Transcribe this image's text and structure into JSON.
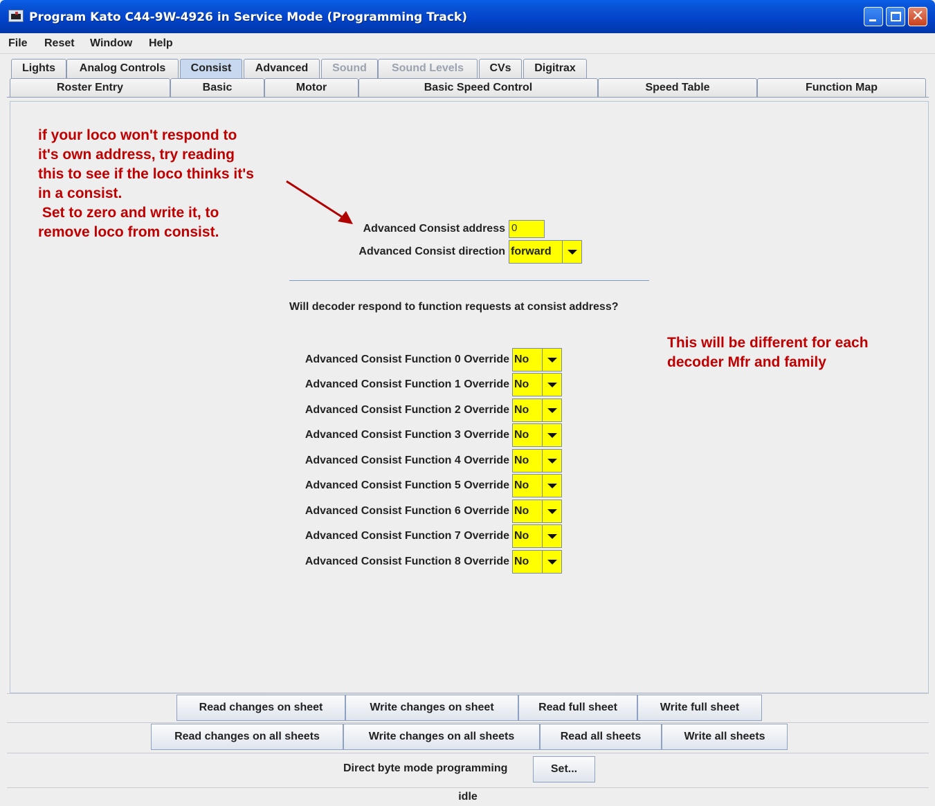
{
  "window": {
    "title": "Program Kato C44-9W-4926 in Service Mode (Programming Track)"
  },
  "menubar": {
    "items": [
      "File",
      "Reset",
      "Window",
      "Help"
    ]
  },
  "tabs": {
    "row1": [
      {
        "label": "Lights",
        "state": "normal"
      },
      {
        "label": "Analog Controls",
        "state": "normal"
      },
      {
        "label": "Consist",
        "state": "selected"
      },
      {
        "label": "Advanced",
        "state": "normal"
      },
      {
        "label": "Sound",
        "state": "disabled"
      },
      {
        "label": "Sound Levels",
        "state": "disabled"
      },
      {
        "label": "CVs",
        "state": "normal"
      },
      {
        "label": "Digitrax",
        "state": "normal"
      }
    ],
    "row2": [
      {
        "label": "Roster Entry"
      },
      {
        "label": "Basic"
      },
      {
        "label": "Motor"
      },
      {
        "label": "Basic Speed Control"
      },
      {
        "label": "Speed Table"
      },
      {
        "label": "Function Map"
      }
    ]
  },
  "annotations": {
    "left": [
      "if your loco won't respond to",
      "it's own address, try reading",
      "this to see if the loco thinks it's",
      "in a consist.",
      " Set to zero and write it, to",
      "remove loco from consist."
    ],
    "right": [
      "This will be different for each",
      "decoder Mfr and family"
    ],
    "color": "#c00000"
  },
  "consist": {
    "address_label": "Advanced Consist address",
    "address_value": "0",
    "direction_label": "Advanced Consist direction",
    "direction_value": "forward",
    "question": "Will decoder respond to function requests at consist address?",
    "overrides": [
      {
        "label": "Advanced Consist Function 0 Override",
        "value": "No"
      },
      {
        "label": "Advanced Consist Function 1 Override",
        "value": "No"
      },
      {
        "label": "Advanced Consist Function 2 Override",
        "value": "No"
      },
      {
        "label": "Advanced Consist Function 3 Override",
        "value": "No"
      },
      {
        "label": "Advanced Consist Function 4 Override",
        "value": "No"
      },
      {
        "label": "Advanced Consist Function 5 Override",
        "value": "No"
      },
      {
        "label": "Advanced Consist Function 6 Override",
        "value": "No"
      },
      {
        "label": "Advanced Consist Function 7 Override",
        "value": "No"
      },
      {
        "label": "Advanced Consist Function 8 Override",
        "value": "No"
      }
    ],
    "field_color": "#ffff00"
  },
  "sheet_buttons": {
    "read_changes": "Read changes on sheet",
    "write_changes": "Write changes on sheet",
    "read_full": "Read full sheet",
    "write_full": "Write full sheet"
  },
  "all_buttons": {
    "read_changes_all": "Read changes on all sheets",
    "write_changes_all": "Write changes on all sheets",
    "read_all": "Read all sheets",
    "write_all": "Write all sheets"
  },
  "programming": {
    "mode_label": "Direct byte mode programming",
    "set_button": "Set..."
  },
  "status": "idle"
}
